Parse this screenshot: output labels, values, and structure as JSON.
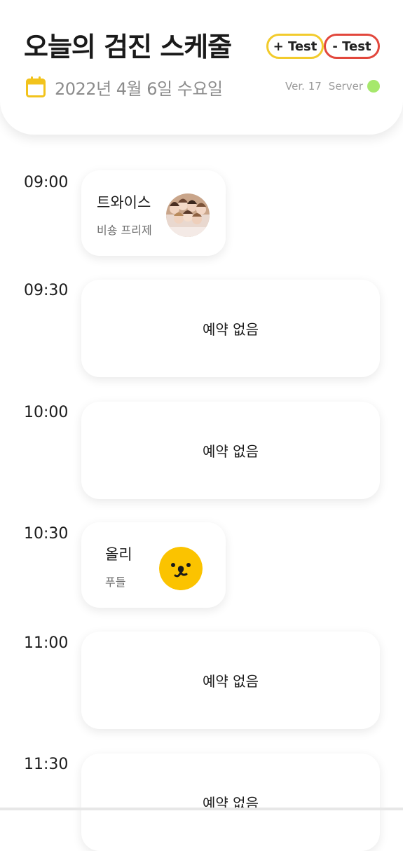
{
  "header": {
    "title": "오늘의 검진 스케줄",
    "test_plus_label": "+ Test",
    "test_minus_label": "- Test",
    "date": "2022년 4월 6일 수요일",
    "version": "Ver. 17",
    "server_label": "Server",
    "server_status_color": "#a6e86c",
    "calendar_icon": "calendar-icon"
  },
  "colors": {
    "accent_yellow": "#f2cb2c",
    "accent_red": "#e2473c"
  },
  "schedule": [
    {
      "time": "09:00",
      "type": "booking",
      "name": "트와이스",
      "breed": "비숑 프리제",
      "avatar": "group-photo"
    },
    {
      "time": "09:30",
      "type": "empty",
      "label": "예약 없음"
    },
    {
      "time": "10:00",
      "type": "empty",
      "label": "예약 없음"
    },
    {
      "time": "10:30",
      "type": "booking",
      "name": "올리",
      "breed": "푸들",
      "avatar": "yellow-face-icon"
    },
    {
      "time": "11:00",
      "type": "empty",
      "label": "예약 없음"
    },
    {
      "time": "11:30",
      "type": "empty",
      "label": "예약 없음"
    }
  ]
}
